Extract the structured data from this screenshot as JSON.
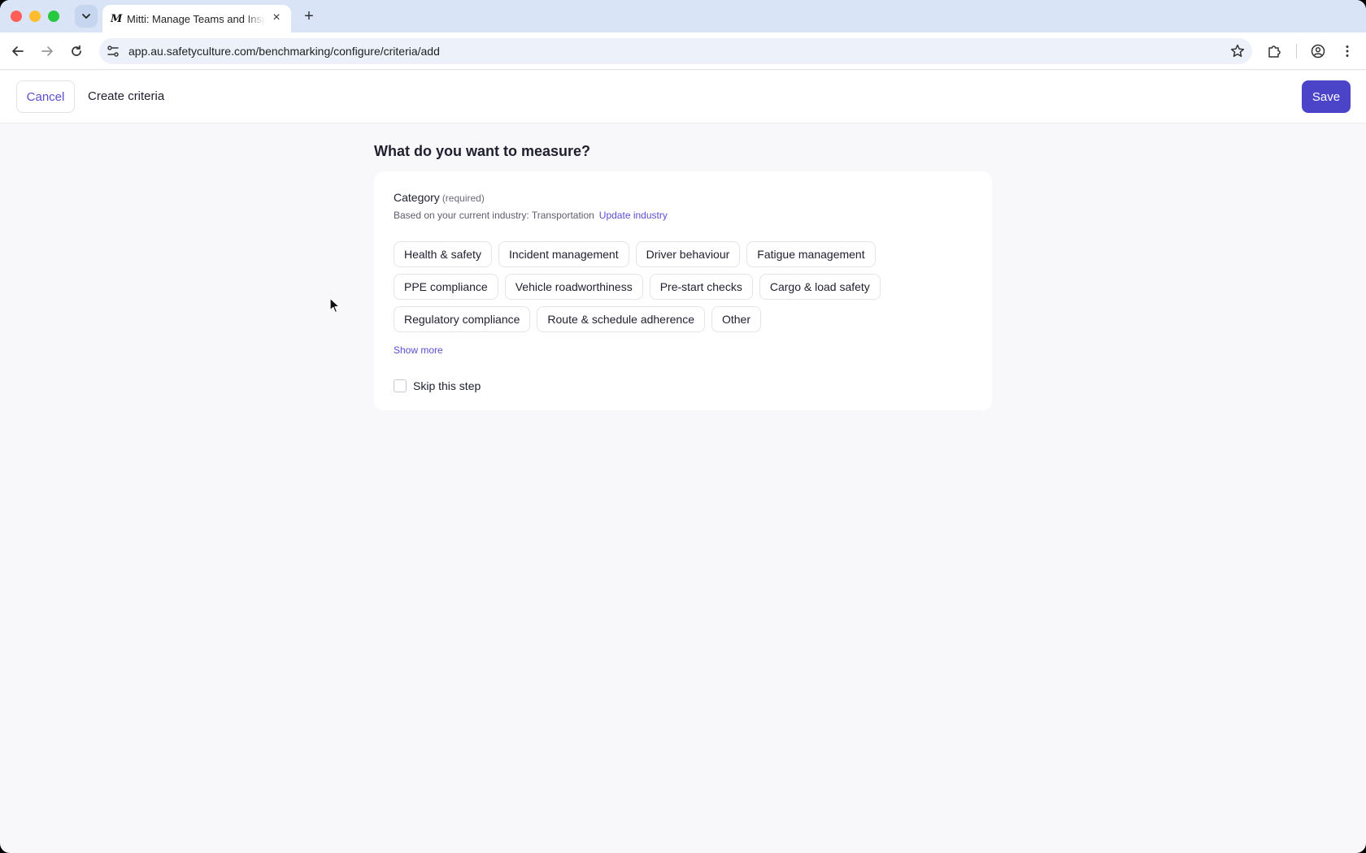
{
  "browser": {
    "tab_title": "Mitti: Manage Teams and Inspections",
    "tab_favicon": "M",
    "url": "app.au.safetyculture.com/benchmarking/configure/criteria/add"
  },
  "header": {
    "cancel_label": "Cancel",
    "title": "Create criteria",
    "save_label": "Save"
  },
  "main": {
    "question": "What do you want to measure?",
    "category_label": "Category",
    "category_required": "(required)",
    "industry_text": "Based on your current industry: Transportation",
    "update_industry": "Update industry",
    "categories_row1": [
      "Health & safety",
      "Incident management",
      "Driver behaviour",
      "Fatigue management"
    ],
    "categories_row2": [
      "PPE compliance",
      "Vehicle roadworthiness",
      "Pre-start checks",
      "Cargo & load safety"
    ],
    "categories_row3": [
      "Regulatory compliance",
      "Route & schedule adherence",
      "Other"
    ],
    "show_more": "Show more",
    "skip_label": "Skip this step"
  },
  "colors": {
    "accent": "#5a4fcf",
    "save_button": "#4b44c8",
    "page_bg": "#f8f7fa"
  }
}
